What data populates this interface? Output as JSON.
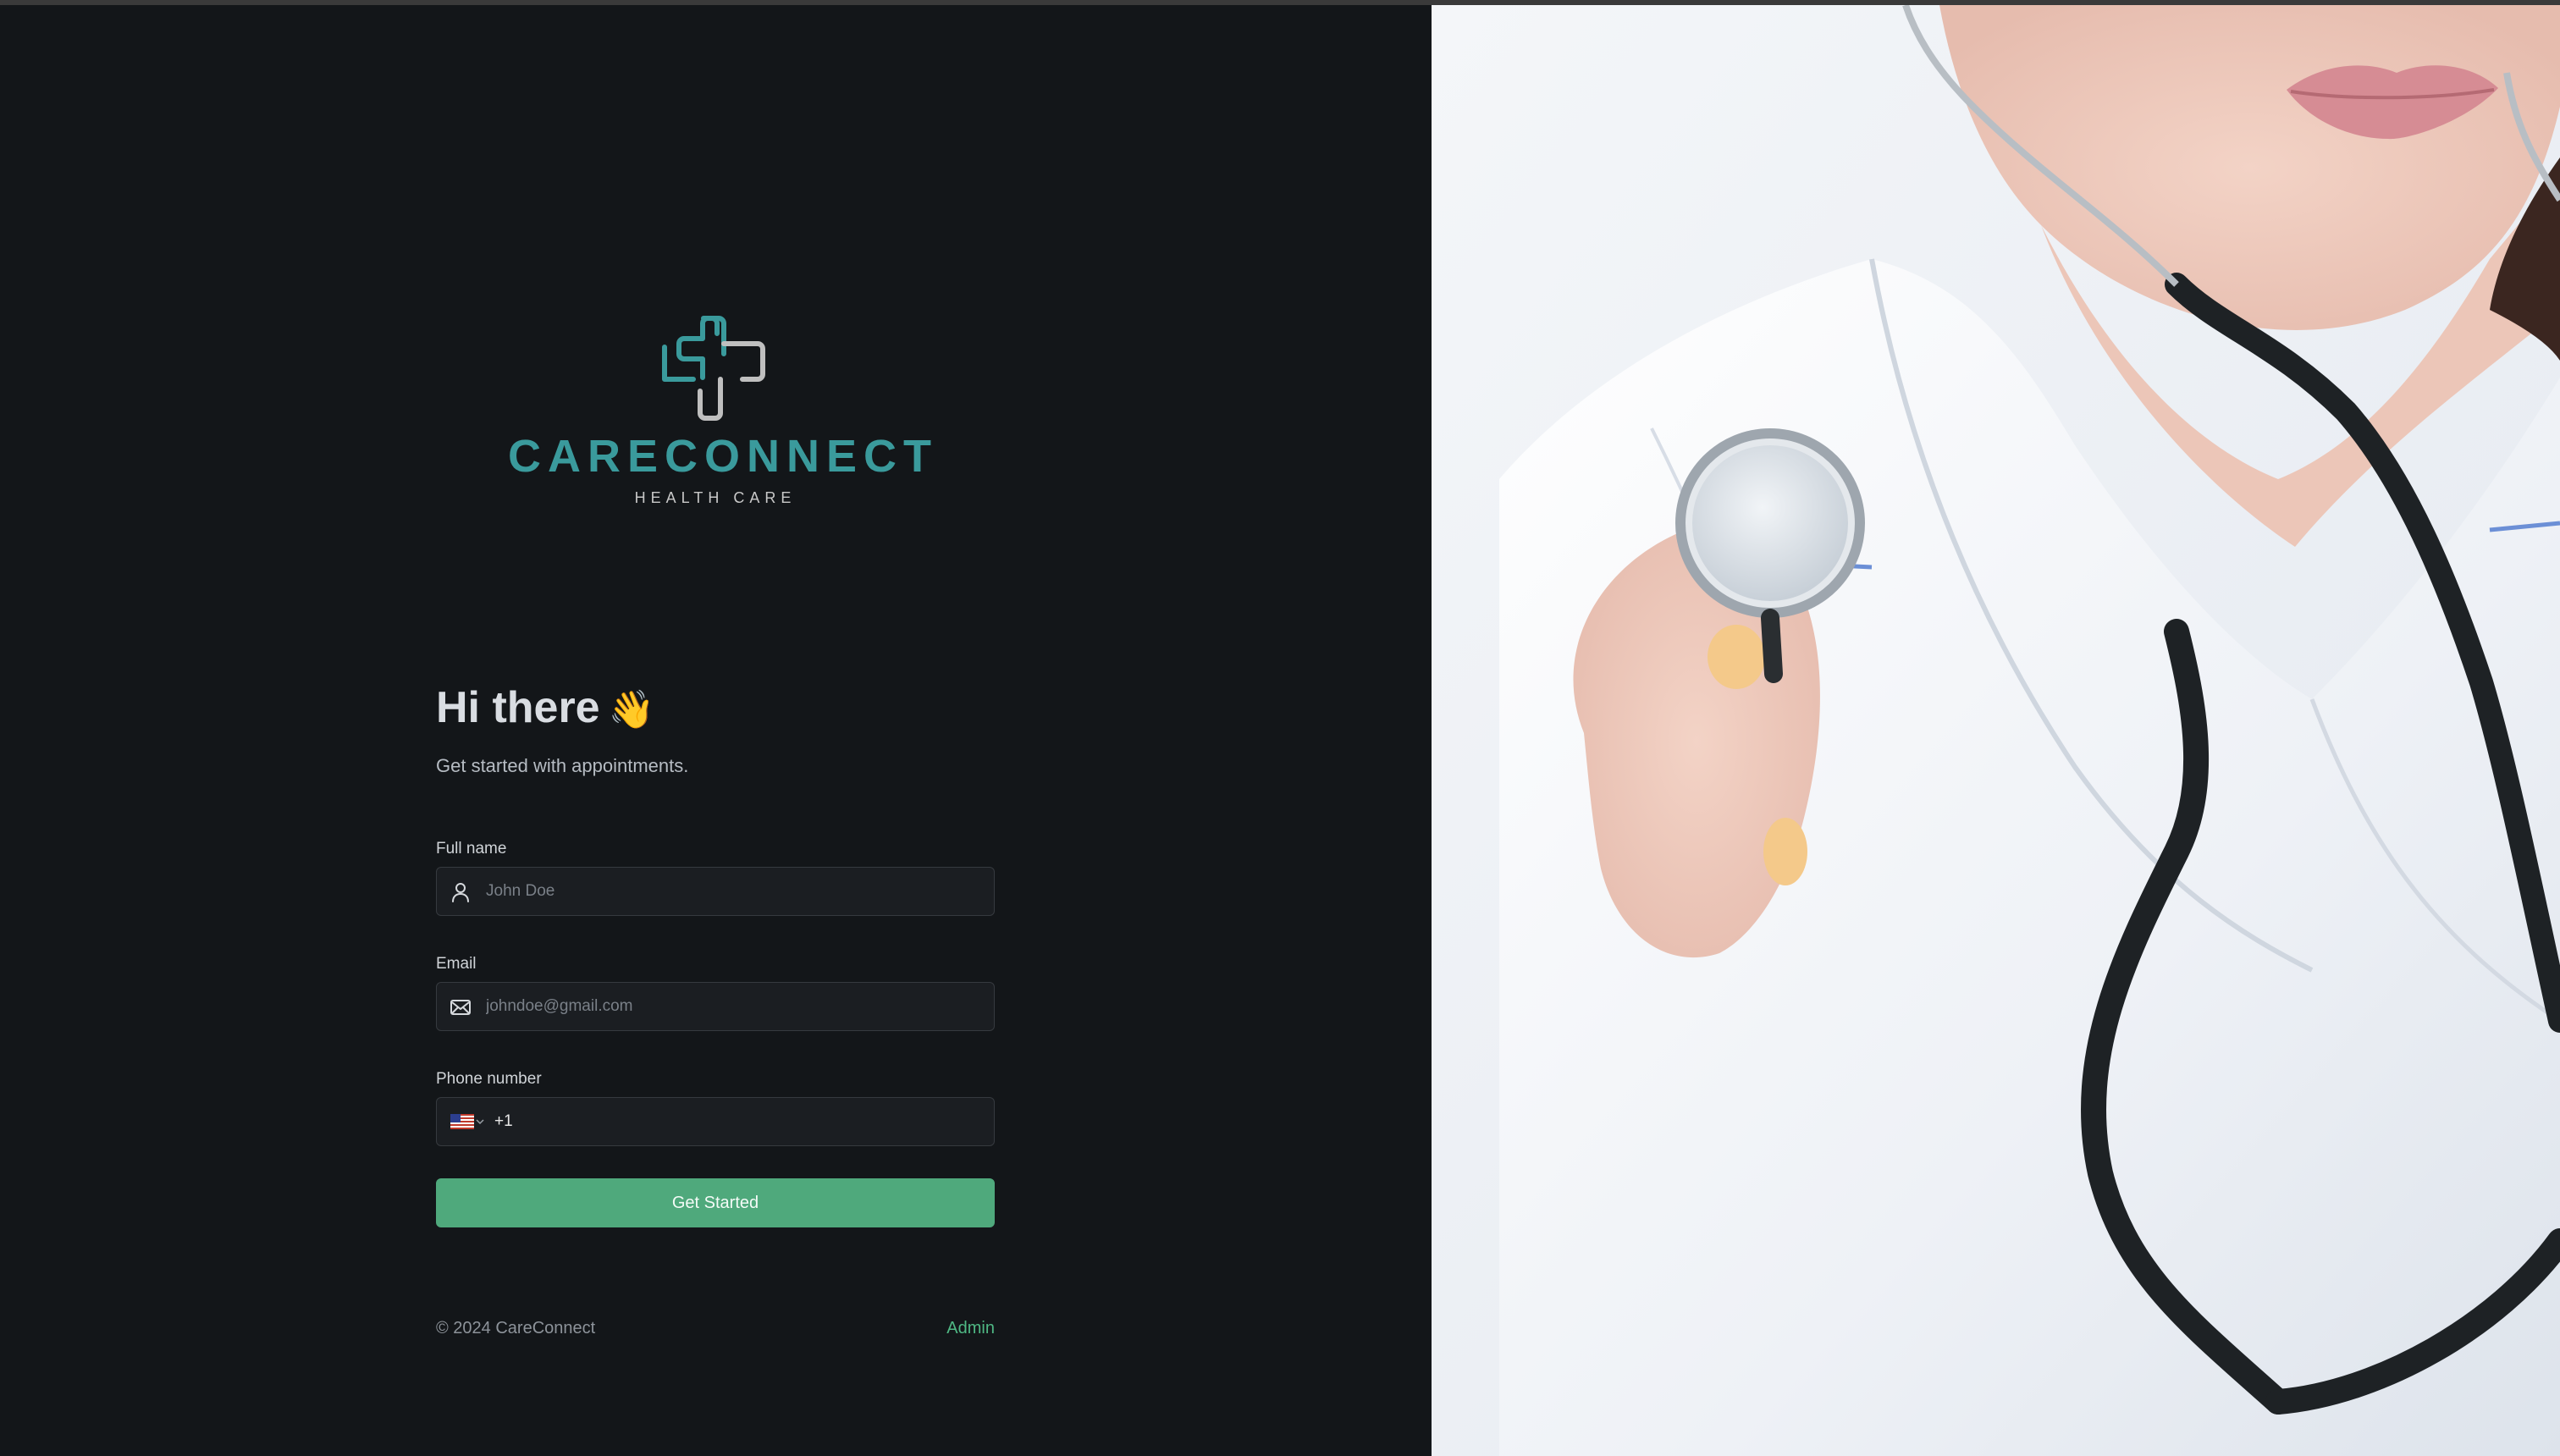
{
  "brand": {
    "name": "CARECONNECT",
    "tagline": "HEALTH CARE",
    "accent_color": "#3a9a9c"
  },
  "hero": {
    "greeting": "Hi there",
    "wave_emoji": "👋",
    "subtitle": "Get started with appointments."
  },
  "form": {
    "full_name": {
      "label": "Full name",
      "placeholder": "John Doe",
      "icon": "user-icon"
    },
    "email": {
      "label": "Email",
      "placeholder": "johndoe@gmail.com",
      "icon": "mail-icon"
    },
    "phone": {
      "label": "Phone number",
      "country_flag": "us-flag-icon",
      "dial_code": "+1"
    },
    "submit_label": "Get Started",
    "submit_color": "#4fa97c"
  },
  "footer": {
    "copyright": "© 2024 CareConnect",
    "admin_link": "Admin",
    "admin_color": "#4fb884"
  }
}
